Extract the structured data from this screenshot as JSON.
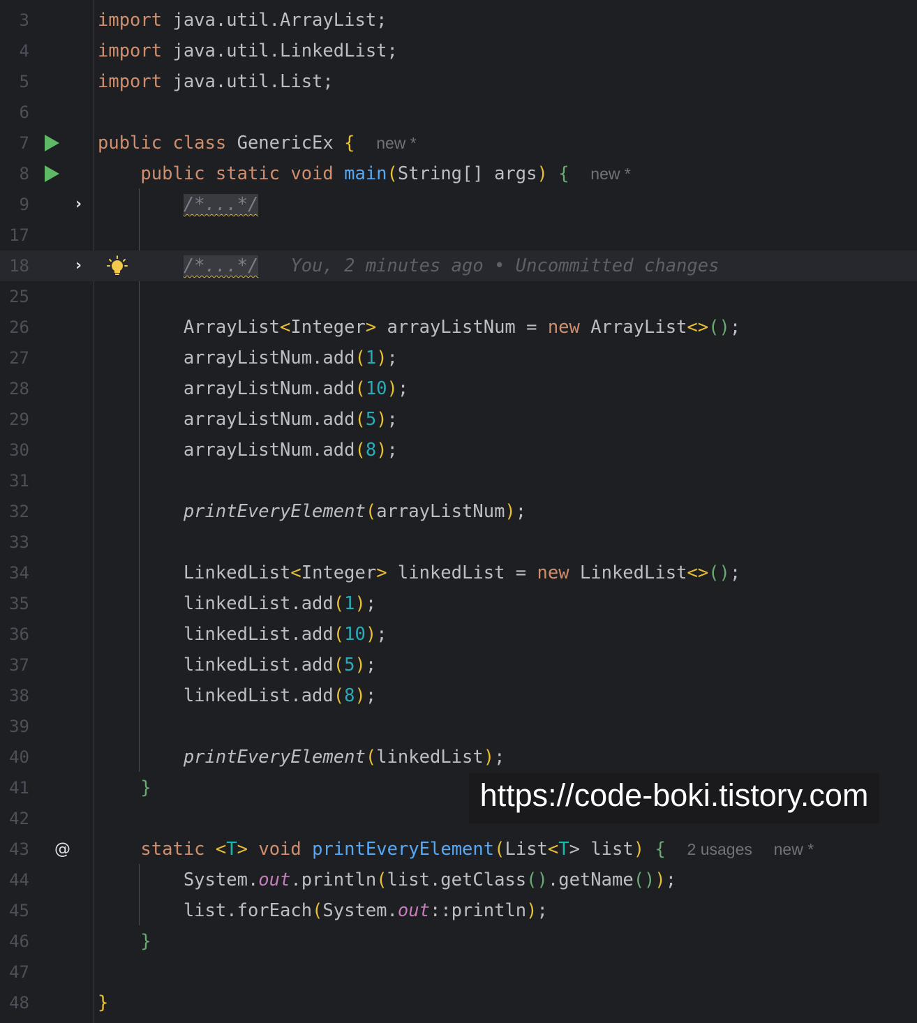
{
  "editor": {
    "line_numbers": [
      "3",
      "4",
      "5",
      "6",
      "7",
      "8",
      "9",
      "17",
      "18",
      "25",
      "26",
      "27",
      "28",
      "29",
      "30",
      "31",
      "32",
      "33",
      "34",
      "35",
      "36",
      "37",
      "38",
      "39",
      "40",
      "41",
      "42",
      "43",
      "44",
      "45",
      "46",
      "47",
      "48"
    ],
    "fold_text": "/*...*/",
    "blame": "You, 2 minutes ago • Uncommitted changes",
    "hints": {
      "new": "new *",
      "usages": "2 usages"
    },
    "icons": {
      "run": "run-icon",
      "fold": "chevron-right-icon",
      "bulb": "lightbulb-icon",
      "implements": "at-sign-icon"
    },
    "colors": {
      "background": "#1e1f22",
      "keyword": "#cf8e6d",
      "function": "#56a8f5",
      "number": "#2aacb8",
      "bracket": "#e8bf35",
      "run": "#5fb865"
    }
  },
  "code": {
    "imp1": {
      "kw": "import",
      "rest": " java.util.ArrayList;"
    },
    "imp2": {
      "kw": "import",
      "rest": " java.util.LinkedList;"
    },
    "imp3": {
      "kw": "import",
      "rest": " java.util.List;"
    },
    "cls": {
      "kw": "public class",
      "name": " GenericEx ",
      "brace": "{"
    },
    "main": {
      "kw": "public static void",
      "name": "main",
      "lp": "(",
      "params": "String[] args",
      "rp": ")",
      "brace": "{"
    },
    "al_decl": {
      "type": "ArrayList",
      "lt": "<",
      "gtype": "Integer",
      "gt": ">",
      "mid": " arrayListNum = ",
      "kwnew": "new",
      "type2": " ArrayList",
      "diamond": "<>",
      "call": "()",
      "semi": ";"
    },
    "al_adds": [
      {
        "recv": "arrayListNum.add",
        "arg": "1"
      },
      {
        "recv": "arrayListNum.add",
        "arg": "10"
      },
      {
        "recv": "arrayListNum.add",
        "arg": "5"
      },
      {
        "recv": "arrayListNum.add",
        "arg": "8"
      }
    ],
    "print1": {
      "fn": "printEveryElement",
      "arg": "arrayListNum"
    },
    "ll_decl": {
      "type": "LinkedList",
      "lt": "<",
      "gtype": "Integer",
      "gt": ">",
      "mid": " linkedList = ",
      "kwnew": "new",
      "type2": " LinkedList",
      "diamond": "<>",
      "call": "()",
      "semi": ";"
    },
    "ll_adds": [
      {
        "recv": "linkedList.add",
        "arg": "1"
      },
      {
        "recv": "linkedList.add",
        "arg": "10"
      },
      {
        "recv": "linkedList.add",
        "arg": "5"
      },
      {
        "recv": "linkedList.add",
        "arg": "8"
      }
    ],
    "print2": {
      "fn": "printEveryElement",
      "arg": "linkedList"
    },
    "close_brace": "}",
    "pe_decl": {
      "kw": "static",
      "tp_open": "<",
      "tp": "T",
      "tp_close": ">",
      "kw2": "void",
      "name": "printEveryElement",
      "lp": "(",
      "ptype": "List",
      "lt": "<",
      "gtp": "T",
      "gt": "> list",
      "rp": ")",
      "brace": "{"
    },
    "sysout1": {
      "sys": "System.",
      "out": "out",
      "println": ".println",
      "lp": "(",
      "arg": "list.getClass",
      "p1": "()",
      "get": ".getName",
      "p2": "()",
      "rp": ")",
      "semi": ";"
    },
    "sysout2": {
      "lst": "list.forEach",
      "lp": "(",
      "sys": "System.",
      "out": "out",
      "ref": "::println",
      "rp": ")",
      "semi": ";"
    }
  },
  "watermark": "https://code-boki.tistory.com"
}
